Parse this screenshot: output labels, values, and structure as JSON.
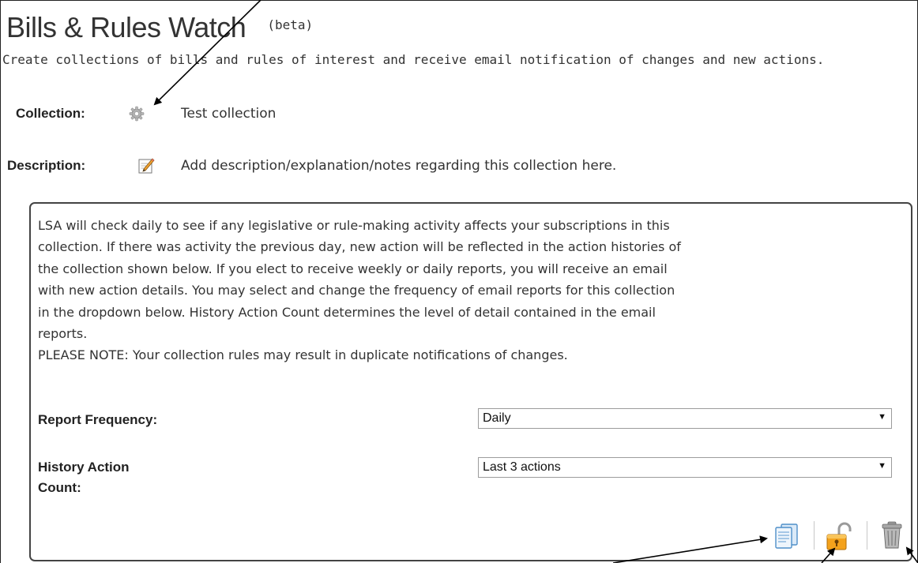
{
  "header": {
    "title": "Bills & Rules Watch",
    "beta": "(beta)",
    "subtitle": "Create collections of bills and rules of interest and receive email notification of changes and new actions."
  },
  "collection": {
    "label": "Collection:",
    "value": "Test collection",
    "icon": "gear-icon"
  },
  "description": {
    "label": "Description:",
    "value": "Add description/explanation/notes regarding this collection here.",
    "icon": "pencil-icon"
  },
  "panel": {
    "info_lines": [
      "LSA will check daily to see if any legislative or rule-making activity affects your subscriptions in this",
      "collection. If there was activity the previous day, new action will be reflected in the action histories of",
      "the collection shown below. If you elect to receive weekly or daily reports, you will receive an email",
      "with new action details. You may select and change the frequency of email reports for this collection",
      "in the dropdown below. History Action Count determines the level of detail contained in the email",
      "reports.",
      "PLEASE NOTE: Your collection rules may result in duplicate notifications of changes."
    ],
    "report_frequency": {
      "label": "Report Frequency:",
      "selected": "Daily"
    },
    "history_action_count": {
      "label_line1": "History Action",
      "label_line2": "Count:",
      "selected": "Last 3 actions"
    },
    "actions": [
      "copy-icon",
      "unlock-icon",
      "trash-icon"
    ]
  },
  "colors": {
    "text": "#333333",
    "border": "#444444",
    "arrow": "#000000"
  }
}
